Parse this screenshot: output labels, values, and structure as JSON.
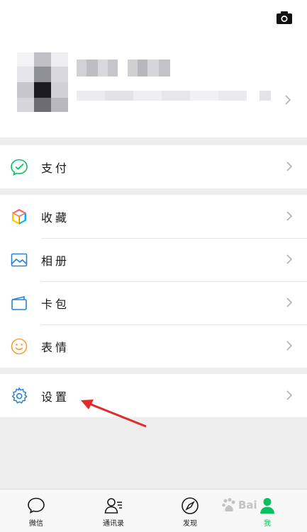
{
  "menu": {
    "pay": "支付",
    "favorites": "收藏",
    "album": "相册",
    "cards": "卡包",
    "stickers": "表情",
    "settings": "设置"
  },
  "tabs": {
    "chats": "微信",
    "contacts": "通讯录",
    "discover": "发现",
    "me": "我"
  },
  "watermark": "Bai",
  "colors": {
    "brand_green": "#07c160",
    "settings_blue": "#2782d7",
    "annotation_red": "#e32a2a"
  }
}
